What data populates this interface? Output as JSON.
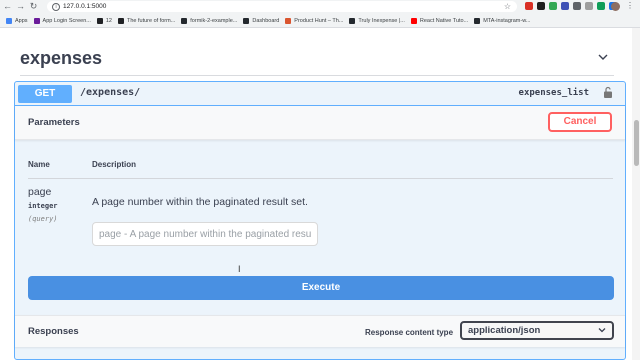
{
  "browser": {
    "url": "127.0.0.1:5000",
    "back_icon": "arrow-left-icon",
    "forward_icon": "arrow-right-icon",
    "reload_icon": "reload-icon",
    "bookmarks": [
      {
        "label": "Apps",
        "color": "#4285f4"
      },
      {
        "label": "App Login Screen...",
        "color": "#6a1b9a"
      },
      {
        "label": "12",
        "color": "#202124"
      },
      {
        "label": "The future of form...",
        "color": "#202124"
      },
      {
        "label": "formik-2-example...",
        "color": "#24292e"
      },
      {
        "label": "Dashboard",
        "color": "#24292e"
      },
      {
        "label": "Product Hunt – Th...",
        "color": "#da552f"
      },
      {
        "label": "Truly Inexpense |...",
        "color": "#24292e"
      },
      {
        "label": "React Native Tuto...",
        "color": "#ff0000"
      },
      {
        "label": "MTA-instagram-w...",
        "color": "#24292e"
      }
    ]
  },
  "tag": {
    "title": "expenses"
  },
  "operation": {
    "method": "GET",
    "path": "/expenses/",
    "operation_id": "expenses_list",
    "method_color": "#61affe"
  },
  "parameters": {
    "title": "Parameters",
    "cancel_label": "Cancel",
    "col_name": "Name",
    "col_description": "Description",
    "items": [
      {
        "name": "page",
        "type": "integer",
        "in": "(query)",
        "description": "A page number within the paginated result set.",
        "placeholder": "page - A page number within the paginated result set."
      }
    ]
  },
  "execute_label": "Execute",
  "responses": {
    "title": "Responses",
    "content_type_label": "Response content type",
    "content_type_value": "application/json"
  },
  "colors": {
    "execute": "#4990e2",
    "cancel": "#ff6060"
  }
}
